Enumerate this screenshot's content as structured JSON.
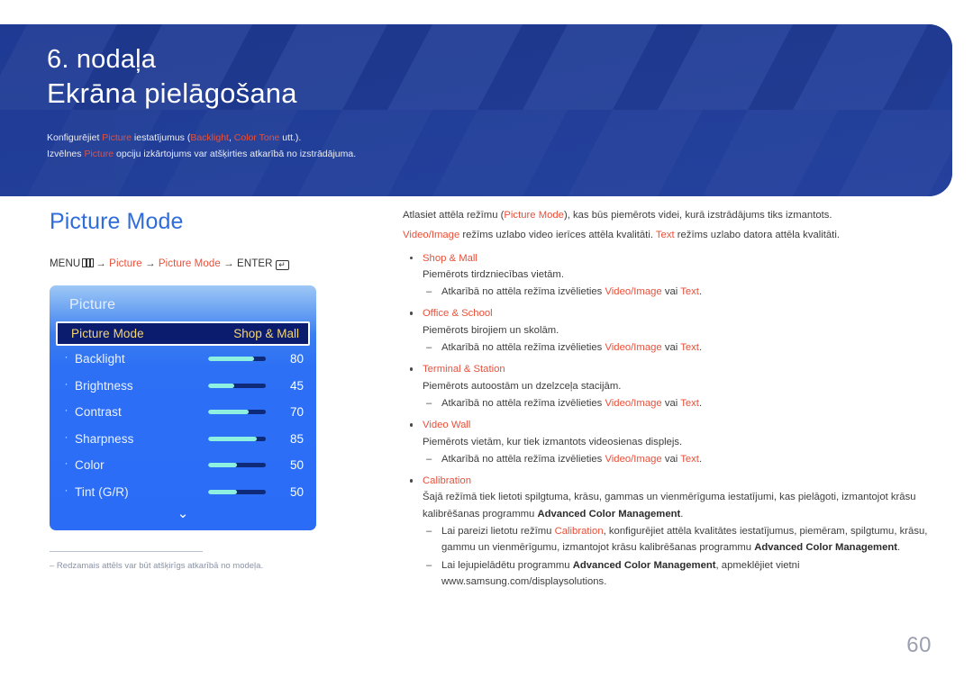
{
  "banner": {
    "chapter_number": "6. nodaļa",
    "chapter_title": "Ekrāna pielāgošana",
    "note_line1_a": "Konfigurējiet ",
    "note_line1_kw1": "Picture",
    "note_line1_b": " iestatījumus (",
    "note_line1_kw2": "Backlight",
    "note_line1_c": ", ",
    "note_line1_kw3": "Color Tone",
    "note_line1_d": " utt.).",
    "note_line2_a": "Izvēlnes ",
    "note_line2_kw1": "Picture",
    "note_line2_b": " opciju izkārtojums var atšķirties atkarībā no izstrādājuma.",
    "bg_color": "#1f3c96"
  },
  "left": {
    "section_title": "Picture Mode",
    "breadcrumb": {
      "menu_label": "MENU",
      "menu_icon": "menu-grid-icon",
      "arrow1": "→",
      "crumb1": "Picture",
      "arrow2": "→",
      "crumb2": "Picture Mode",
      "arrow3": "→",
      "enter_label": "ENTER",
      "enter_icon": "enter-key-icon",
      "enter_glyph": "↵"
    },
    "osd": {
      "title": "Picture",
      "selected_row": {
        "label": "Picture Mode",
        "value": "Shop & Mall"
      },
      "rows": [
        {
          "label": "Backlight",
          "value": "80",
          "pct": 80
        },
        {
          "label": "Brightness",
          "value": "45",
          "pct": 45
        },
        {
          "label": "Contrast",
          "value": "70",
          "pct": 70
        },
        {
          "label": "Sharpness",
          "value": "85",
          "pct": 85
        },
        {
          "label": "Color",
          "value": "50",
          "pct": 50
        },
        {
          "label": "Tint (G/R)",
          "value": "50",
          "pct": 50
        }
      ],
      "chevron": "⌄",
      "accent_fill": "#8ef0e0",
      "track_color": "#0e2a78",
      "selected_bg": "#0b1b6e",
      "selected_text": "#f5d76e"
    }
  },
  "footnote": {
    "text": "‒  Redzamais attēls var būt atšķirīgs atkarībā no modeļa."
  },
  "right": {
    "lead1_a": "Atlasiet attēla režīmu (",
    "lead1_kw": "Picture Mode",
    "lead1_b": "), kas būs piemērots videi, kurā izstrādājums tiks izmantots.",
    "lead2_kw1": "Video/Image",
    "lead2_a": " režīms uzlabo video ierīces attēla kvalitāti. ",
    "lead2_kw2": "Text",
    "lead2_b": " režīms uzlabo datora attēla kvalitāti.",
    "items": [
      {
        "title": "Shop & Mall",
        "desc": "Piemērots tirdzniecības vietām.",
        "subs": [
          {
            "a": "Atkarībā no attēla režīma izvēlieties ",
            "kw1": "Video/Image",
            "b": " vai ",
            "kw2": "Text",
            "c": "."
          }
        ]
      },
      {
        "title": "Office & School",
        "desc": "Piemērots birojiem un skolām.",
        "subs": [
          {
            "a": "Atkarībā no attēla režīma izvēlieties ",
            "kw1": "Video/Image",
            "b": " vai ",
            "kw2": "Text",
            "c": "."
          }
        ]
      },
      {
        "title": "Terminal & Station",
        "desc": "Piemērots autoostām un dzelzceļa stacijām.",
        "subs": [
          {
            "a": "Atkarībā no attēla režīma izvēlieties ",
            "kw1": "Video/Image",
            "b": " vai ",
            "kw2": "Text",
            "c": "."
          }
        ]
      },
      {
        "title": "Video Wall",
        "desc": "Piemērots vietām, kur tiek izmantots videosienas displejs.",
        "subs": [
          {
            "a": "Atkarībā no attēla režīma izvēlieties ",
            "kw1": "Video/Image",
            "b": " vai ",
            "kw2": "Text",
            "c": "."
          }
        ]
      }
    ],
    "calibration": {
      "title": "Calibration",
      "desc_a": "Šajā režīmā tiek lietoti spilgtuma, krāsu, gammas un vienmērīguma iestatījumi, kas pielāgoti, izmantojot krāsu kalibrēšanas programmu ",
      "desc_bold": "Advanced Color Management",
      "desc_b": ".",
      "sub1_a": "Lai pareizi lietotu režīmu ",
      "sub1_kw": "Calibration",
      "sub1_b": ", konfigurējiet attēla kvalitātes iestatījumus, piemēram, spilgtumu, krāsu, gammu un vienmērīgumu, izmantojot krāsu kalibrēšanas programmu ",
      "sub1_bold": "Advanced Color Management",
      "sub1_c": ".",
      "sub2_a": "Lai lejupielādētu programmu ",
      "sub2_bold": "Advanced Color Management",
      "sub2_b": ", apmeklējiet vietni www.samsung.com/displaysolutions."
    }
  },
  "page_number": "60"
}
